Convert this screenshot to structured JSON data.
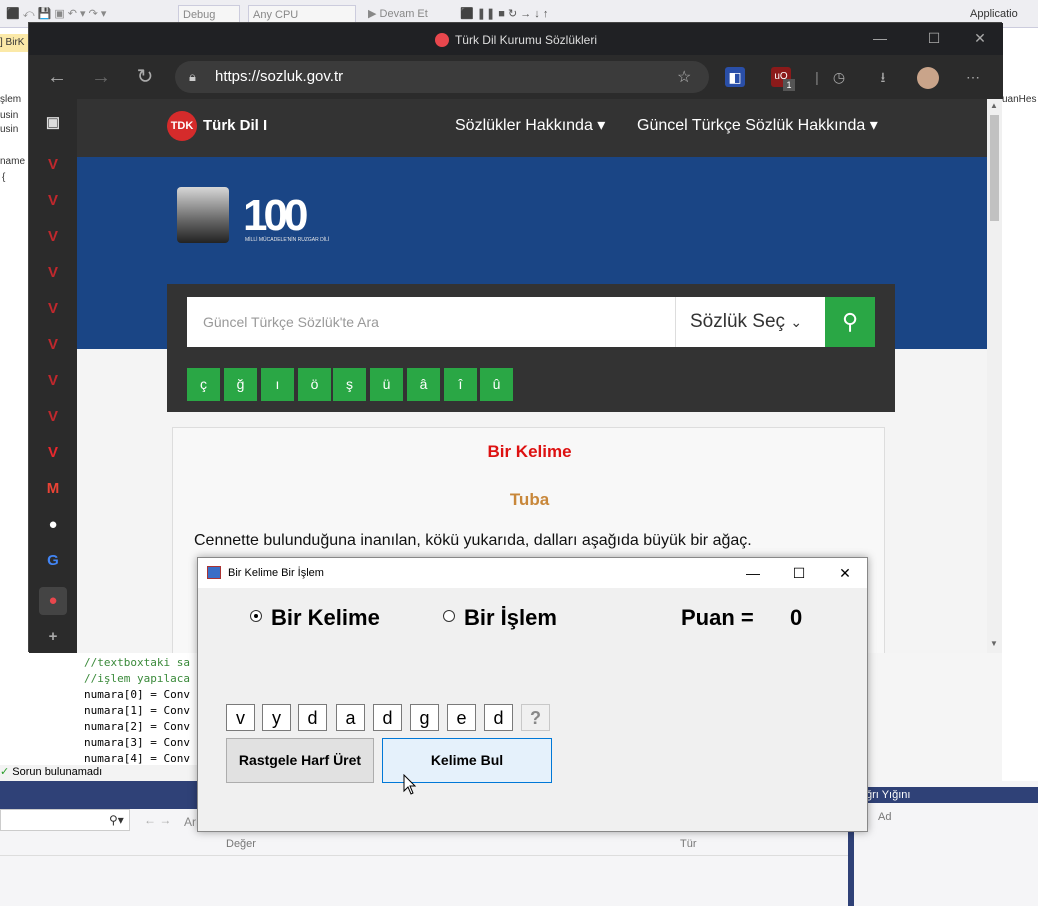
{
  "vs": {
    "toolbar": {
      "config": "Debug",
      "platform": "Any CPU",
      "run": "Devam Et",
      "app_label": "Applicatio"
    },
    "left_tab": "] BirK",
    "left_labels": [
      "şlem",
      "usin",
      "usin",
      "name",
      "{"
    ],
    "right_label": "uanHes",
    "code_lines": [
      "//textboxtaki sa",
      "//işlem yapılaca",
      "numara[0] = Conv",
      "numara[1] = Conv",
      "numara[2] = Conv",
      "numara[3] = Conv",
      "numara[4] = Conv"
    ],
    "status": "Sorun bulunamadı",
    "col_value": "Değer",
    "col_type": "Tür",
    "search_hint": "Ar",
    "callstack_title": "ğrı Yığını",
    "callstack_col": "Ad"
  },
  "browser": {
    "title": "Türk Dil Kurumu Sözlükleri",
    "url": "https://sozluk.gov.tr",
    "ext_badge": "1"
  },
  "site": {
    "logo_text": "Türk Dil I",
    "menu": [
      "Sözlükler Hakkında ▾",
      "Güncel Türkçe Sözlük Hakkında ▾"
    ],
    "hundred": "100",
    "hundred_sub": "MİLLİ MÜCADELE'NİN RUZGAR DİLİ",
    "search_placeholder": "Güncel Türkçe Sözlük'te Ara",
    "dict_select": "Sözlük Seç",
    "chars": [
      "ç",
      "ğ",
      "ı",
      "ö",
      "ş",
      "ü",
      "â",
      "î",
      "û"
    ],
    "card_title": "Bir Kelime",
    "card_word": "Tuba",
    "card_def": "Cennette bulunduğuna inanılan, kökü yukarıda, dalları aşağıda büyük bir ağaç."
  },
  "dialog": {
    "title": "Bir Kelime Bir İşlem",
    "radio_word": "Bir Kelime",
    "radio_op": "Bir İşlem",
    "score_label": "Puan =",
    "score_value": "0",
    "letters": [
      "v",
      "y",
      "d",
      "a",
      "d",
      "g",
      "e",
      "d",
      "?"
    ],
    "btn_random": "Rastgele Harf Üret",
    "btn_find": "Kelime Bul"
  }
}
